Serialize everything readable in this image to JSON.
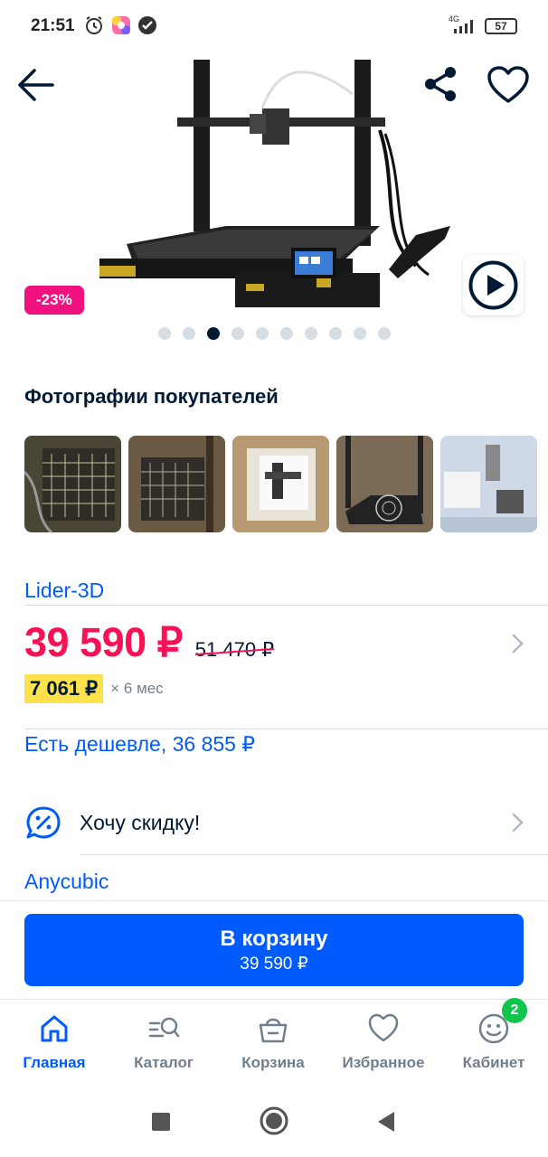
{
  "status_bar": {
    "time": "21:51",
    "network": "4G",
    "battery": "57",
    "icons": [
      "alarm-icon",
      "gallery-app-icon",
      "check-circle-icon",
      "signal-icon",
      "battery-icon"
    ]
  },
  "header": {
    "icons": [
      "back-arrow-icon",
      "share-icon",
      "heart-icon"
    ]
  },
  "gallery": {
    "discount": "-23%",
    "dot_count": 10,
    "active_dot": 2
  },
  "customer_photos": {
    "title": "Фотографии покупателей",
    "count": 5
  },
  "seller": {
    "name": "Lider-3D"
  },
  "price": {
    "current": "39 590 ₽",
    "old": "51 470 ₽",
    "installment_amount": "7 061 ₽",
    "installment_term": "× 6 мес"
  },
  "cheaper": {
    "label": "Есть дешевле, 36 855 ₽"
  },
  "want_discount": {
    "label": "Хочу скидку!"
  },
  "brand": {
    "name": "Anycubic"
  },
  "cart_button": {
    "label": "В корзину",
    "price": "39 590 ₽"
  },
  "tabbar": {
    "tabs": [
      {
        "label": "Главная",
        "icon": "home-icon",
        "active": true
      },
      {
        "label": "Каталог",
        "icon": "catalog-search-icon",
        "active": false
      },
      {
        "label": "Корзина",
        "icon": "basket-icon",
        "active": false
      },
      {
        "label": "Избранное",
        "icon": "heart-icon",
        "active": false
      },
      {
        "label": "Кабинет",
        "icon": "profile-face-icon",
        "active": false
      }
    ],
    "cabinet_badge": "2"
  },
  "colors": {
    "accent": "#005bff",
    "price": "#f91155",
    "discount_badge": "#f1117e",
    "installment_bg": "#ffe14b",
    "badge_green": "#10c44c",
    "text": "#001a34",
    "muted": "#707f8d"
  }
}
